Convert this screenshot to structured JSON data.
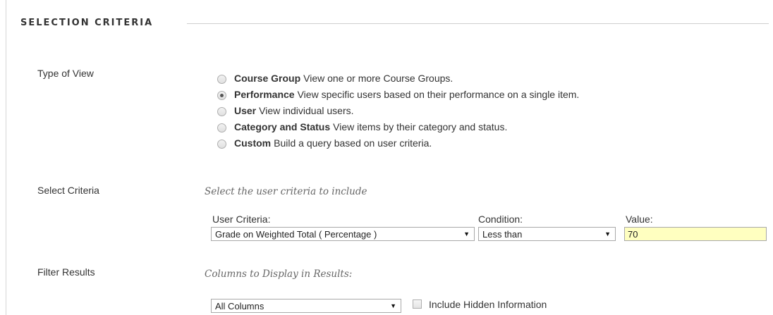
{
  "section": {
    "title": "SELECTION CRITERIA"
  },
  "type_of_view": {
    "label": "Type of View",
    "options": [
      {
        "name": "Course Group",
        "desc": "View one or more Course Groups.",
        "checked": false
      },
      {
        "name": "Performance",
        "desc": "View specific users based on their performance on a single item.",
        "checked": true
      },
      {
        "name": "User",
        "desc": "View individual users.",
        "checked": false
      },
      {
        "name": "Category and Status",
        "desc": "View items by their category and status.",
        "checked": false
      },
      {
        "name": "Custom",
        "desc": "Build a query based on user criteria.",
        "checked": false
      }
    ]
  },
  "select_criteria": {
    "label": "Select Criteria",
    "hint": "Select the user criteria to include",
    "user_criteria_label": "User Criteria:",
    "user_criteria_value": "Grade on Weighted Total ( Percentage )",
    "condition_label": "Condition:",
    "condition_value": "Less than",
    "value_label": "Value:",
    "value": "70"
  },
  "filter_results": {
    "label": "Filter Results",
    "hint": "Columns to Display in Results:",
    "columns_value": "All Columns",
    "include_hidden_label": "Include Hidden Information"
  },
  "icons": {
    "dropdown": "▼"
  },
  "colors": {
    "value_field_bg": "#ffffc0"
  }
}
